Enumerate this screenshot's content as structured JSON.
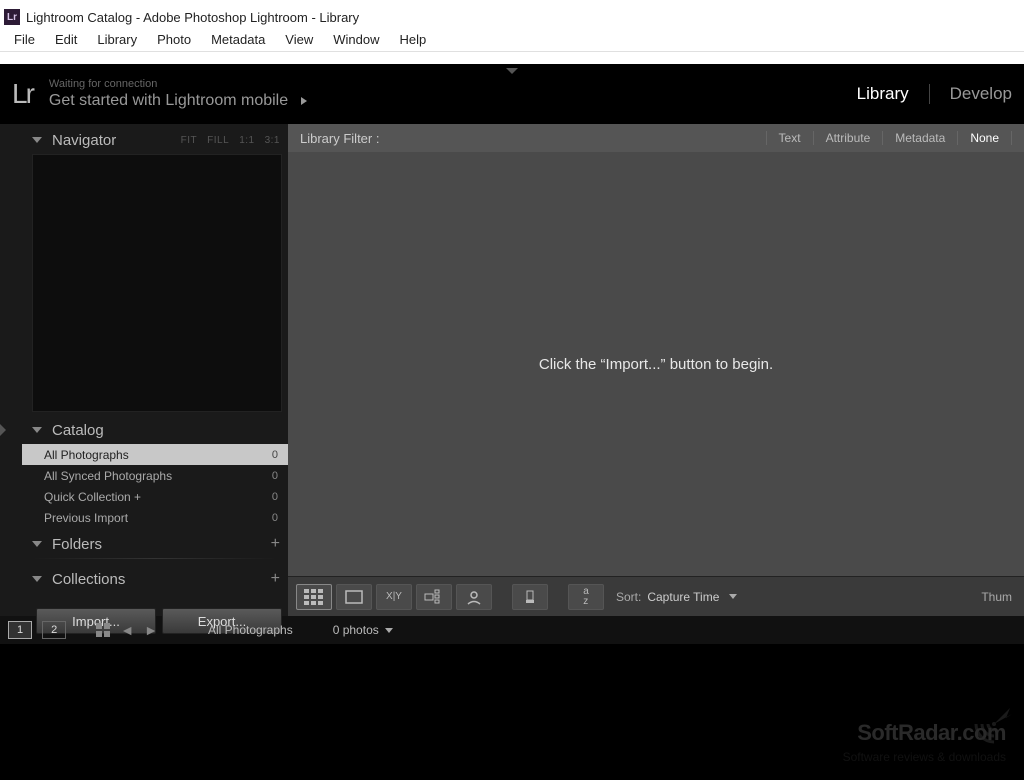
{
  "window": {
    "title": "Lightroom Catalog - Adobe Photoshop Lightroom - Library",
    "icon_label": "Lr"
  },
  "menubar": [
    "File",
    "Edit",
    "Library",
    "Photo",
    "Metadata",
    "View",
    "Window",
    "Help"
  ],
  "brand": {
    "logo": "Lr",
    "connection": "Waiting for connection",
    "getstarted": "Get started with Lightroom mobile"
  },
  "modules": {
    "library": "Library",
    "develop": "Develop"
  },
  "left": {
    "navigator": {
      "title": "Navigator",
      "opts": [
        "FIT",
        "FILL",
        "1:1",
        "3:1"
      ]
    },
    "catalog": {
      "title": "Catalog",
      "rows": [
        {
          "label": "All Photographs",
          "count": "0"
        },
        {
          "label": "All Synced Photographs",
          "count": "0"
        },
        {
          "label": "Quick Collection  +",
          "count": "0"
        },
        {
          "label": "Previous Import",
          "count": "0"
        }
      ]
    },
    "folders": "Folders",
    "collections": "Collections",
    "import_btn": "Import...",
    "export_btn": "Export..."
  },
  "center": {
    "filter_label": "Library Filter :",
    "filters": {
      "text": "Text",
      "attribute": "Attribute",
      "metadata": "Metadata",
      "none": "None"
    },
    "empty_msg": "Click the “Import...” button to begin.",
    "sort_label": "Sort:",
    "sort_value": "Capture Time",
    "thumb_label": "Thum"
  },
  "status": {
    "screen1": "1",
    "screen2": "2",
    "path": "All Photographs",
    "count": "0 photos"
  },
  "watermark": {
    "brand": "SoftRadar.com",
    "sub": "Software reviews & downloads"
  }
}
